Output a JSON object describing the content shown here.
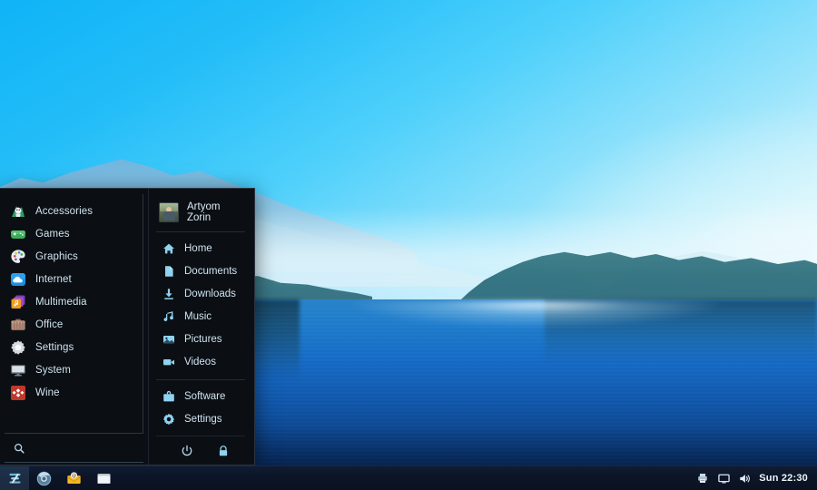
{
  "desktop": {
    "wallpaper_name": "zorin-lake-mountains-wallpaper",
    "colors": {
      "sky_top": "#0fb4f7",
      "sky_bottom": "#eefbfe",
      "water_top": "#2a82c8",
      "water_bottom": "#041a3f",
      "menu_bg": "#0b0f14",
      "menu_border": "#2a3440",
      "taskbar_bg": "#0c1527",
      "text": "#cfe3ef",
      "icon_accent": "#8fd3f0"
    }
  },
  "menu": {
    "categories": [
      {
        "label": "Accessories",
        "icon": "accessories-icon"
      },
      {
        "label": "Games",
        "icon": "games-gamepad-icon"
      },
      {
        "label": "Graphics",
        "icon": "graphics-palette-icon"
      },
      {
        "label": "Internet",
        "icon": "internet-cloud-icon"
      },
      {
        "label": "Multimedia",
        "icon": "multimedia-music-icon"
      },
      {
        "label": "Office",
        "icon": "office-briefcase-icon"
      },
      {
        "label": "Settings",
        "icon": "settings-gear-icon"
      },
      {
        "label": "System",
        "icon": "system-monitor-icon"
      },
      {
        "label": "Wine",
        "icon": "wine-icon"
      }
    ],
    "search": {
      "value": "",
      "placeholder": "",
      "icon": "search-icon"
    },
    "user": {
      "name": "Artyom Zorin",
      "avatar": "user-avatar"
    },
    "places": [
      {
        "label": "Home",
        "icon": "home-icon"
      },
      {
        "label": "Documents",
        "icon": "document-icon"
      },
      {
        "label": "Downloads",
        "icon": "download-icon"
      },
      {
        "label": "Music",
        "icon": "music-note-icon"
      },
      {
        "label": "Pictures",
        "icon": "picture-icon"
      },
      {
        "label": "Videos",
        "icon": "video-camera-icon"
      }
    ],
    "shortcuts": [
      {
        "label": "Software",
        "icon": "software-bag-icon"
      },
      {
        "label": "Settings",
        "icon": "gear-icon"
      }
    ],
    "actions": [
      {
        "label": "Power",
        "icon": "power-icon"
      },
      {
        "label": "Lock",
        "icon": "lock-icon"
      }
    ]
  },
  "taskbar": {
    "start": {
      "label": "Zorin Menu",
      "icon": "zorin-logo-icon"
    },
    "launchers": [
      {
        "label": "Web Browser",
        "icon": "chromium-browser-icon"
      },
      {
        "label": "Mail",
        "icon": "mail-envelope-icon"
      },
      {
        "label": "Files",
        "icon": "file-manager-icon"
      }
    ],
    "tray": [
      {
        "label": "Printer",
        "icon": "printer-icon"
      },
      {
        "label": "Display",
        "icon": "display-icon"
      },
      {
        "label": "Volume",
        "icon": "volume-speaker-icon"
      }
    ],
    "clock": "Sun 22:30"
  }
}
